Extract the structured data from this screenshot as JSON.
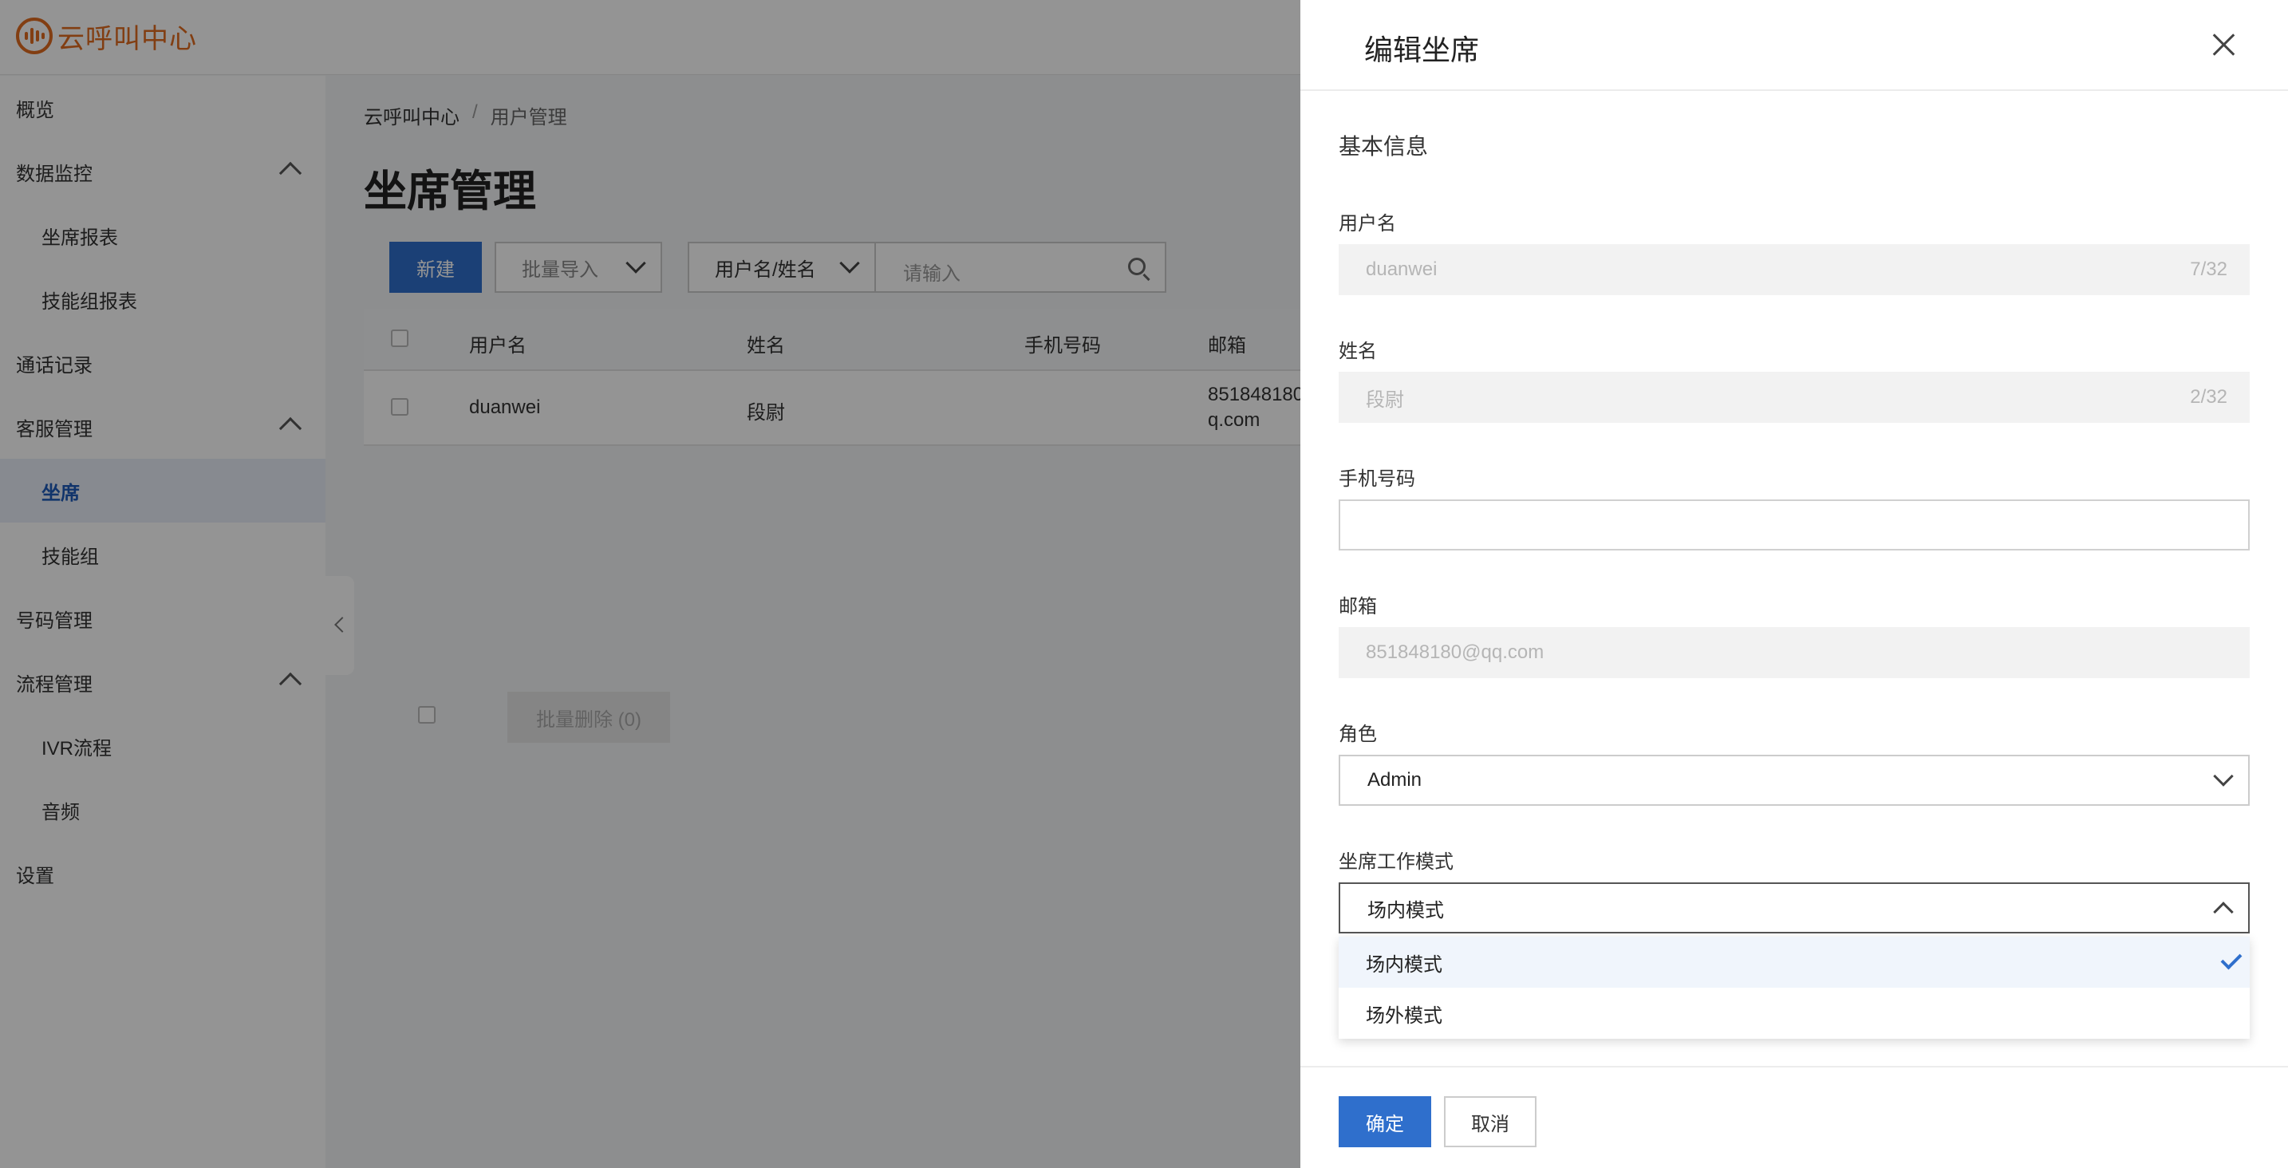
{
  "app": {
    "logo_text": "云呼叫中心"
  },
  "sidebar": {
    "items": [
      {
        "label": "概览"
      },
      {
        "label": "数据监控"
      },
      {
        "label": "坐席报表"
      },
      {
        "label": "技能组报表"
      },
      {
        "label": "通话记录"
      },
      {
        "label": "客服管理"
      },
      {
        "label": "坐席"
      },
      {
        "label": "技能组"
      },
      {
        "label": "号码管理"
      },
      {
        "label": "流程管理"
      },
      {
        "label": "IVR流程"
      },
      {
        "label": "音频"
      },
      {
        "label": "设置"
      }
    ]
  },
  "breadcrumb": {
    "root": "云呼叫中心",
    "sep": "/",
    "current": "用户管理"
  },
  "page": {
    "title": "坐席管理"
  },
  "toolbar": {
    "new_label": "新建",
    "import_label": "批量导入",
    "filter_label": "用户名/姓名",
    "search_placeholder": "请输入"
  },
  "table": {
    "columns": [
      "用户名",
      "姓名",
      "手机号码",
      "邮箱"
    ],
    "rows": [
      {
        "username": "duanwei",
        "name": "段尉",
        "phone": "",
        "email_line1": "851848180",
        "email_line2": "q.com"
      }
    ],
    "bulk_delete_label": "批量删除 (0)"
  },
  "drawer": {
    "title": "编辑坐席",
    "section_title": "基本信息",
    "fields": {
      "username": {
        "label": "用户名",
        "value": "duanwei",
        "count": "7/32"
      },
      "name": {
        "label": "姓名",
        "value": "段尉",
        "count": "2/32"
      },
      "phone": {
        "label": "手机号码",
        "value": ""
      },
      "email": {
        "label": "邮箱",
        "value": "851848180@qq.com"
      },
      "role": {
        "label": "角色",
        "value": "Admin"
      },
      "work_mode": {
        "label": "坐席工作模式",
        "value": "场内模式",
        "options": [
          {
            "label": "场内模式",
            "selected": true
          },
          {
            "label": "场外模式",
            "selected": false
          }
        ]
      }
    },
    "confirm_label": "确定",
    "cancel_label": "取消"
  },
  "colors": {
    "primary": "#2f6fcc",
    "brand_orange": "#e06b1f"
  }
}
